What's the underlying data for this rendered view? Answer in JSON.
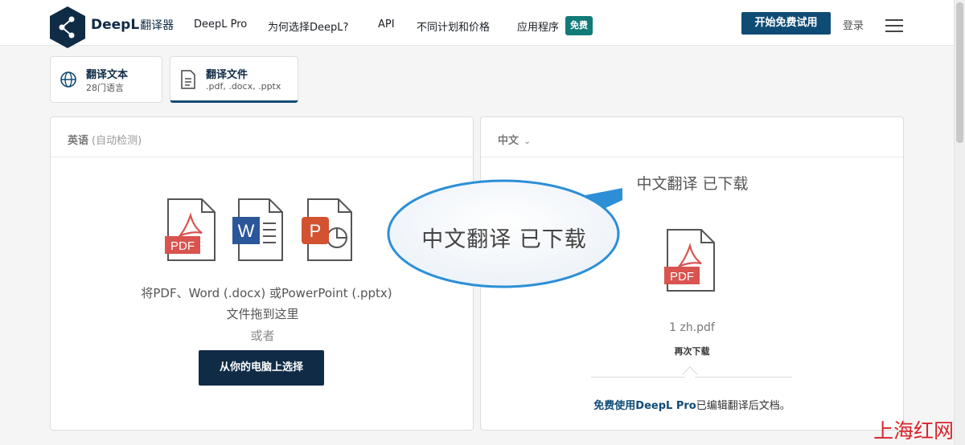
{
  "nav": {
    "brand": "DeepL",
    "brand_sub": "翻译器",
    "links": [
      "DeepL Pro",
      "为何选择DeepL?",
      "API",
      "不同计划和价格",
      "应用程序"
    ],
    "free_badge": "免费",
    "trial_button": "开始免费试用",
    "login": "登录"
  },
  "mode_tabs": [
    {
      "title": "翻译文本",
      "subtitle": "28门语言",
      "icon": "globe-icon"
    },
    {
      "title": "翻译文件",
      "subtitle": ".pdf, .docx, .pptx",
      "icon": "document-icon"
    }
  ],
  "source": {
    "language": "英语",
    "auto_detect": "(自动检测)",
    "file_badges": {
      "pdf": "PDF",
      "word": "W",
      "ppt": "P"
    },
    "drop_line1": "将PDF、Word (.docx) 或PowerPoint (.pptx)",
    "drop_line2": "文件拖到这里",
    "or_text": "或者",
    "choose_button": "从你的电脑上选择"
  },
  "target": {
    "language": "中文",
    "done_title": "中文翻译 已下载",
    "file_badge": "PDF",
    "file_name": "1 zh.pdf",
    "redownload": "再次下载",
    "promo_link": "免费使用DeepL Pro",
    "promo_rest": "已编辑翻译后文档。"
  },
  "callout": {
    "text": "中文翻译 已下载"
  },
  "watermark": "上海红网",
  "colors": {
    "brand_navy": "#0f2b46",
    "accent_blue": "#0f4c75",
    "badge_teal": "#127a79",
    "pdf_red": "#d9534f",
    "word_blue": "#2b579a",
    "ppt_orange": "#d35230",
    "watermark_red": "#d9242b"
  }
}
